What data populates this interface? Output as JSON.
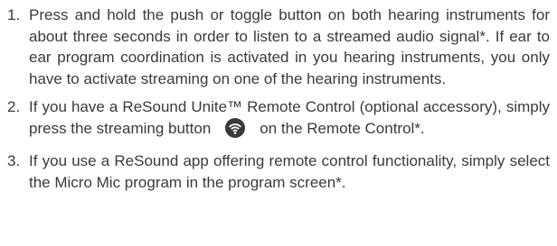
{
  "steps": [
    {
      "number": "1.",
      "text": "Press and hold the push or toggle button on both hearing instruments for about three seconds in order to listen to a streamed audio signal*. If ear to ear program coordination is activated in you hearing instruments, you only have to activate streaming on one of the hearing instruments."
    },
    {
      "number": "2.",
      "text_before_icon": "If you have a ReSound Unite™ Remote Control (optional accessory), simply press the streaming button",
      "icon": "streaming-icon",
      "text_after_icon": "on the Remote Control*."
    },
    {
      "number": "3.",
      "text": "If you use a ReSound app offering remote control functionality, simply select the Micro Mic program in the program screen*."
    }
  ],
  "colors": {
    "text": "#3a3a3a",
    "icon_fill": "#3a3a3a",
    "icon_symbol": "#ffffff"
  }
}
